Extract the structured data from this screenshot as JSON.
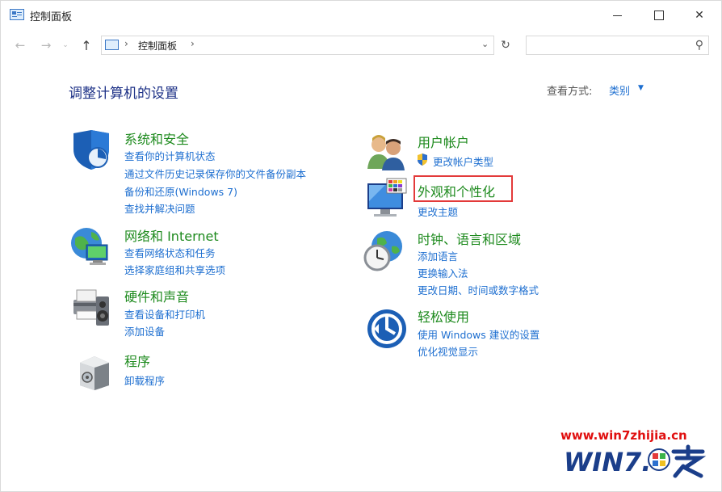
{
  "window": {
    "title": "控制面板",
    "controls": {
      "minimize": "—",
      "maximize": "☐",
      "close": "✕"
    }
  },
  "navigation": {
    "back_icon": "←",
    "forward_icon": "→",
    "recent_icon": "⌄",
    "up_icon": "↑",
    "address": {
      "separator": "›",
      "crumb": "控制面板",
      "dropdown_icon": "⌄"
    },
    "refresh_icon": "↻",
    "search": {
      "placeholder": "",
      "icon": "⚲"
    }
  },
  "content": {
    "heading": "调整计算机的设置",
    "view_by": {
      "label": "查看方式:",
      "value": "类别"
    },
    "categories_left": [
      {
        "title": "系统和安全",
        "links": [
          "查看你的计算机状态",
          "通过文件历史记录保存你的文件备份副本",
          "备份和还原(Windows 7)",
          "查找并解决问题"
        ]
      },
      {
        "title": "网络和 Internet",
        "links": [
          "查看网络状态和任务",
          "选择家庭组和共享选项"
        ]
      },
      {
        "title": "硬件和声音",
        "links": [
          "查看设备和打印机",
          "添加设备"
        ]
      },
      {
        "title": "程序",
        "links": [
          "卸载程序"
        ]
      }
    ],
    "categories_right": [
      {
        "title": "用户帐户",
        "links": [
          "更改帐户类型"
        ]
      },
      {
        "title": "外观和个性化",
        "links": [
          "更改主题"
        ]
      },
      {
        "title": "时钟、语言和区域",
        "links": [
          "添加语言",
          "更换输入法",
          "更改日期、时间或数字格式"
        ]
      },
      {
        "title": "轻松使用",
        "links": [
          "使用 Windows 建议的设置",
          "优化视觉显示"
        ]
      }
    ]
  },
  "watermark": {
    "url": "www.win7zhijia.cn"
  },
  "colors": {
    "title_green": "#1d8a1d",
    "link_blue": "#1e6fd0",
    "heading_blue": "#1e3287",
    "highlight_red": "#e33a3a"
  }
}
